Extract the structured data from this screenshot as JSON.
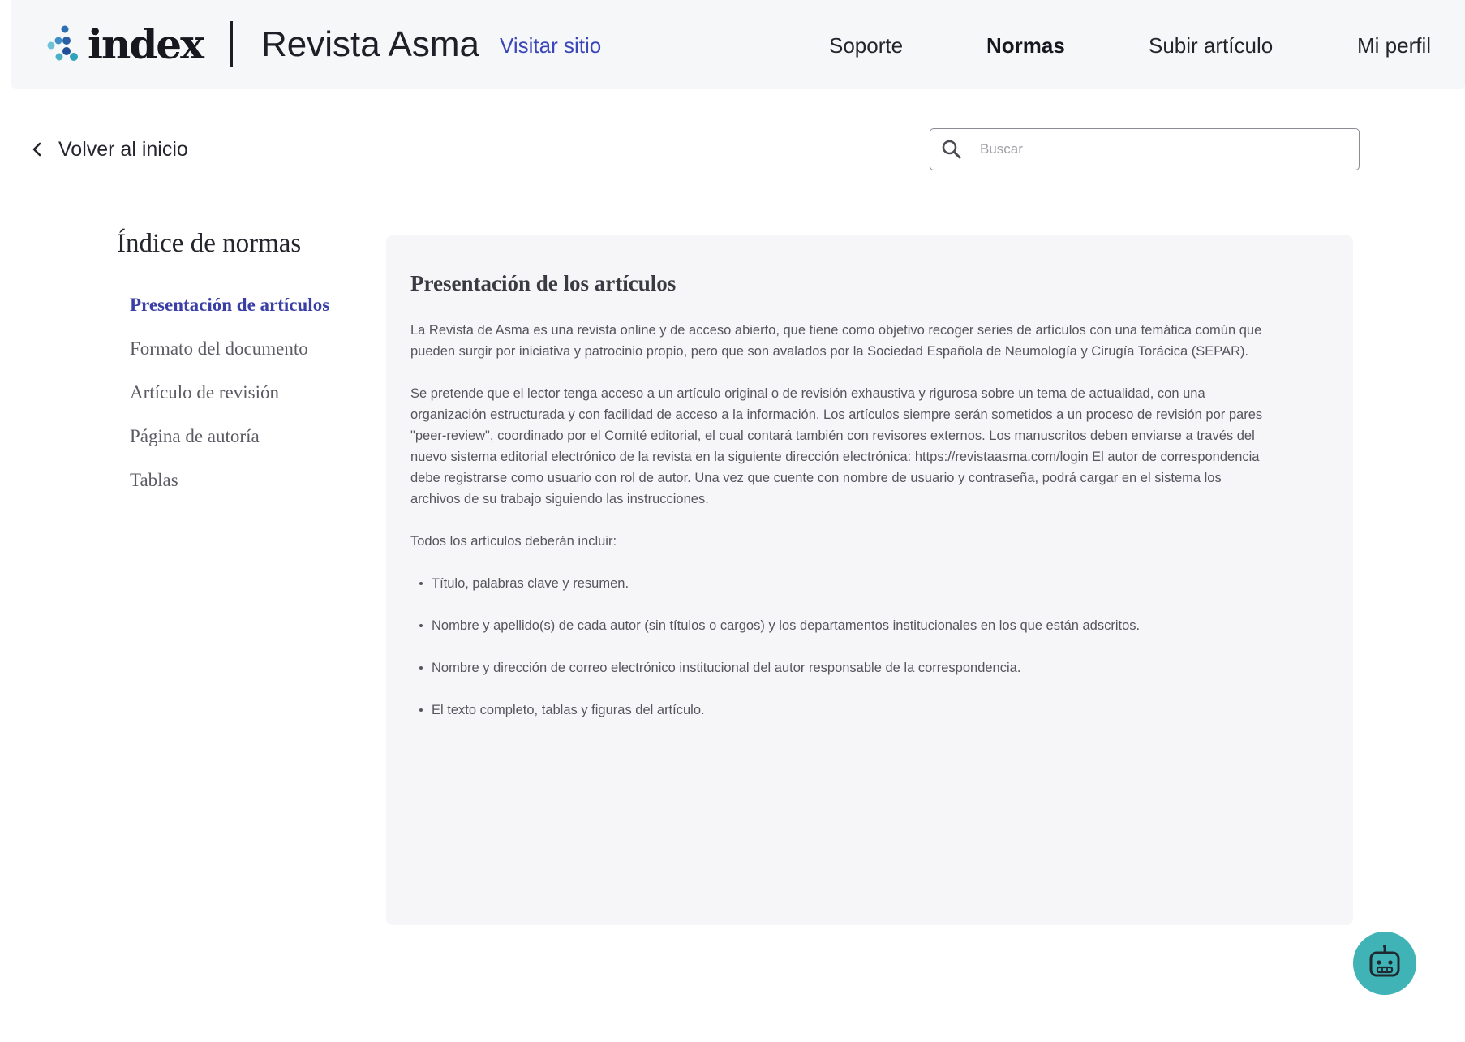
{
  "header": {
    "logo_text": "index",
    "journal_name": "Revista Asma",
    "visit_link": "Visitar sitio",
    "nav": [
      "Soporte",
      "Normas",
      "Subir artículo",
      "Mi perfil"
    ],
    "active_nav": "Normas"
  },
  "back": {
    "label": "Volver al inicio"
  },
  "search": {
    "placeholder": "Buscar",
    "value": ""
  },
  "sidebar": {
    "title": "Índice de normas",
    "items": [
      "Presentación de artículos",
      "Formato del documento",
      "Artículo de revisión",
      "Página de autoría",
      "Tablas"
    ],
    "active_item": "Presentación de artículos"
  },
  "content": {
    "title": "Presentación de los artículos",
    "paragraphs": [
      "La  Revista de Asma es una revista online y de acceso abierto, que tiene como objetivo recoger series de artículos con una temática común que pueden surgir por iniciativa y patrocinio propio, pero que son avalados por la Sociedad Española de Neumología y Cirugía Torácica (SEPAR).",
      "Se pretende que el lector tenga acceso a un artículo original o de revisión exhaustiva y rigurosa sobre un tema de actualidad, con una organización estructurada y con facilidad de acceso a la información. Los artículos siempre serán sometidos a un proceso de revisión por pares \"peer-review\", coordinado por el Comité editorial, el cual contará también con revisores externos. Los manuscritos deben enviarse a través del nuevo sistema editorial electrónico de la revista en la siguiente dirección electrónica: https://revistaasma.com/login El autor de correspondencia debe registrarse como usuario con rol de autor. Una vez que cuente con nombre de usuario y contraseña, podrá cargar en el sistema los archivos de su trabajo siguiendo las instrucciones.",
      "Todos los artículos deberán incluir:"
    ],
    "bullets": [
      "Título, palabras clave y resumen.",
      "Nombre y apellido(s) de cada autor (sin títulos o cargos) y los departamentos institucionales en los que están adscritos.",
      "Nombre y dirección de correo electrónico institucional del autor responsable de la correspondencia.",
      "El texto completo, tablas y figuras del artículo."
    ]
  },
  "icons": {
    "logo": "index-dots-logo-icon",
    "back": "chevron-left-icon",
    "search": "search-icon",
    "bot": "robot-icon"
  },
  "colors": {
    "accent": "#3b46b8",
    "active_sidebar": "#3a3fa6",
    "bot_button": "#3fb3b6",
    "panel_bg": "#f6f6f9",
    "header_bg": "#f6f7f9"
  }
}
